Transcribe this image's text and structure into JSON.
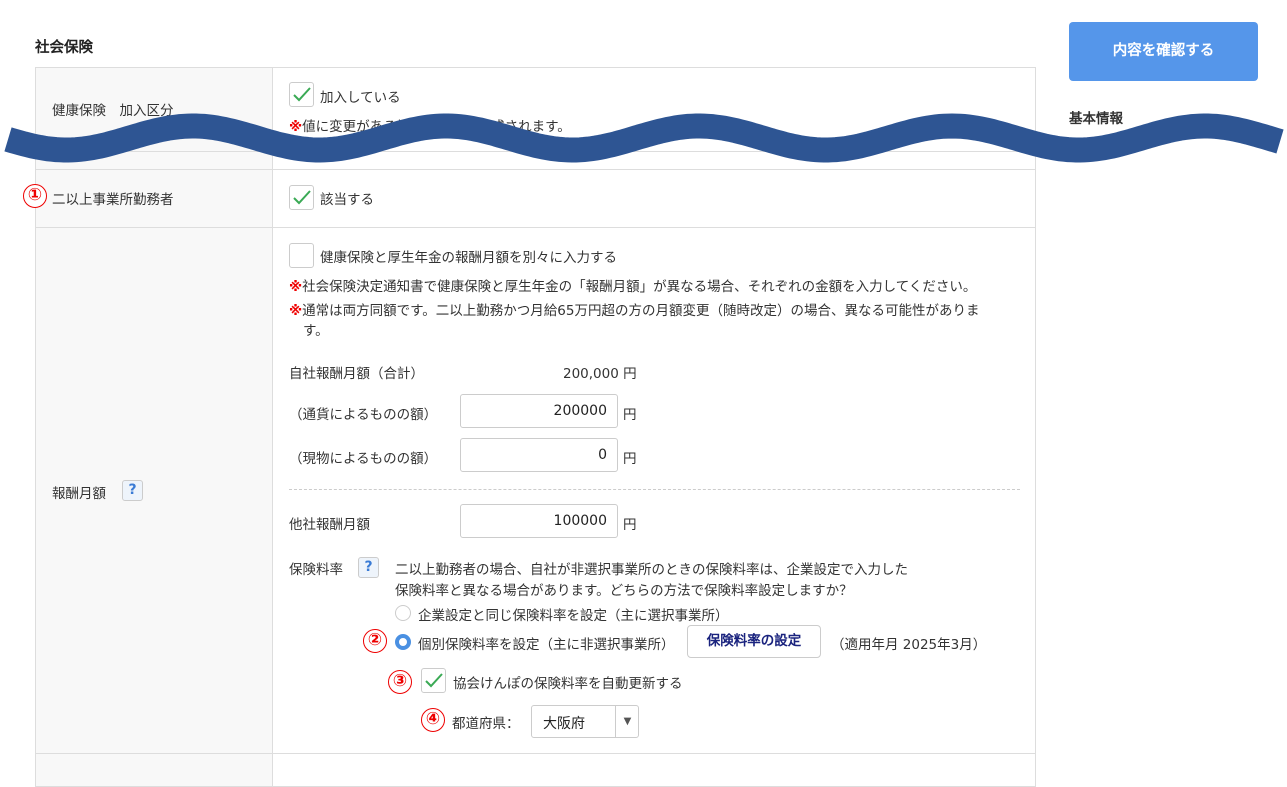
{
  "section_title": "社会保険",
  "confirm_button": "内容を確認する",
  "side_nav": {
    "heading": "基本情報",
    "arrow": "↓"
  },
  "rows": {
    "health_insurance": {
      "label": "健康保険　加入区分",
      "checkbox_label": "加入している",
      "checked": true,
      "note_mark": "※",
      "note": "値に変更がある場合、履歴が作成されます。"
    },
    "multi_office": {
      "marker": "①",
      "label": "二以上事業所勤務者",
      "checkbox_label": "該当する",
      "checked": true
    },
    "monthly_pay": {
      "label": "報酬月額",
      "help": "?",
      "separate_checkbox_label": "健康保険と厚生年金の報酬月額を別々に入力する",
      "separate_checked": false,
      "note_mark": "※",
      "note1": "社会保険決定通知書で健康保険と厚生年金の「報酬月額」が異なる場合、それぞれの金額を入力してください。",
      "note2a": "通常は両方同額です。二以上勤務かつ月給65万円超の方の月額変更（随時改定）の場合、異なる可能性がありま",
      "note2b": "す。",
      "own_total_label": "自社報酬月額（合計）",
      "own_total_value": "200,000 円",
      "currency_label": "（通貨によるものの額）",
      "currency_value": "200000",
      "in_kind_label": "（現物によるものの額）",
      "in_kind_value": "0",
      "other_label": "他社報酬月額",
      "other_value": "100000",
      "yen": "円",
      "rate_label": "保険料率",
      "rate_help": "?",
      "rate_desc1": "二以上勤務者の場合、自社が非選択事業所のときの保険料率は、企業設定で入力した",
      "rate_desc2": "保険料率と異なる場合があります。どちらの方法で保険料率設定しますか？",
      "radio1": "企業設定と同じ保険料率を設定（主に選択事業所）",
      "radio2": "個別保険料率を設定（主に非選択事業所）",
      "selected_radio": 2,
      "marker2": "②",
      "rate_button": "保険料率の設定",
      "applied": "（適用年月 2025年3月）",
      "marker3": "③",
      "auto_update_label": "協会けんぽの保険料率を自動更新する",
      "auto_update_checked": true,
      "marker4": "④",
      "prefecture_label": "都道府県：",
      "prefecture_value": "大阪府"
    }
  },
  "colors": {
    "wave": "#2e5593",
    "primary": "#5596ea",
    "note_mark": "#e00000"
  }
}
